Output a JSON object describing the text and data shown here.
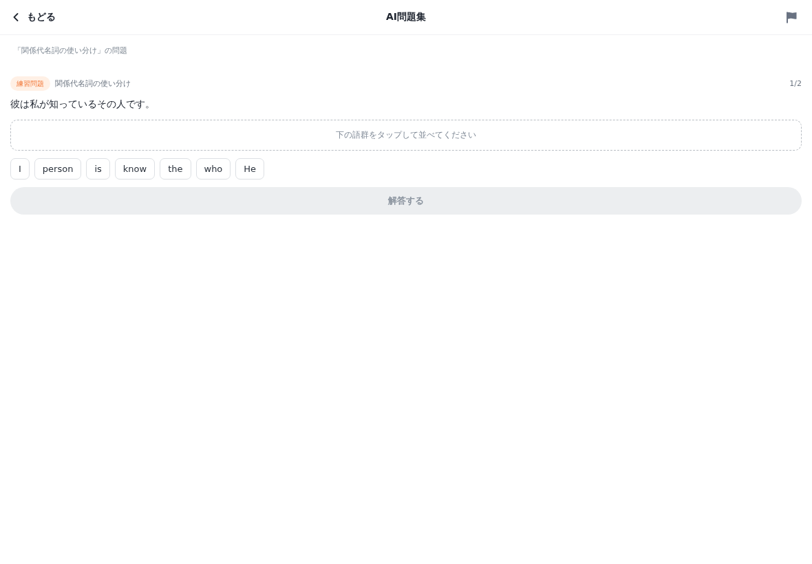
{
  "header": {
    "back_label": "もどる",
    "title": "AI問題集"
  },
  "subtitle": "「関係代名詞の使い分け」の問題",
  "question": {
    "badge": "練習問題",
    "topic": "関係代名詞の使い分け",
    "progress": "1/2",
    "prompt": "彼は私が知っているその人です。",
    "answer_area": {
      "placeholder": "下の語群をタップして並べてください"
    },
    "words": [
      "I",
      "person",
      "is",
      "know",
      "the",
      "who",
      "He"
    ]
  },
  "submit": {
    "label": "解答する",
    "disabled": true
  }
}
